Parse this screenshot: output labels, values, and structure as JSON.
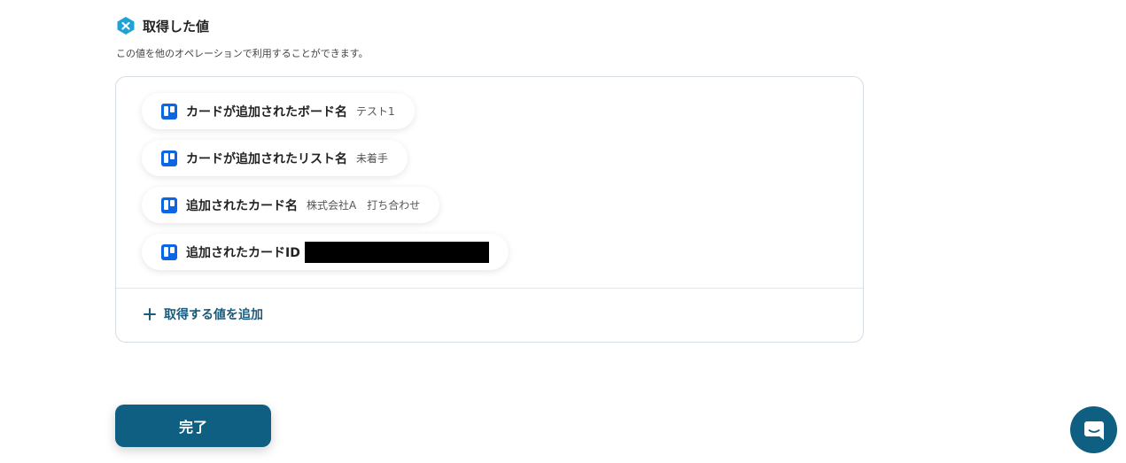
{
  "section": {
    "title": "取得した値",
    "description": "この値を他のオペレーションで利用することができます。",
    "icon": "yoom-logo-icon"
  },
  "values": [
    {
      "label": "カードが追加されたボード名",
      "value": "テスト1",
      "icon": "trello-icon"
    },
    {
      "label": "カードが追加されたリスト名",
      "value": "未着手",
      "icon": "trello-icon"
    },
    {
      "label": "追加されたカード名",
      "value": "株式会社A　打ち合わせ",
      "icon": "trello-icon"
    },
    {
      "label": "追加されたカードID",
      "value": "",
      "redacted": true,
      "icon": "trello-icon"
    }
  ],
  "add_value": {
    "label": "取得する値を追加",
    "icon": "plus-icon"
  },
  "done_button": {
    "label": "完了"
  },
  "chat": {
    "icon": "chat-bubble-icon"
  },
  "colors": {
    "primary": "#0f5f82",
    "link": "#1a5a7a",
    "brand": "#1fa3d6",
    "trello": "#0c66e4"
  }
}
